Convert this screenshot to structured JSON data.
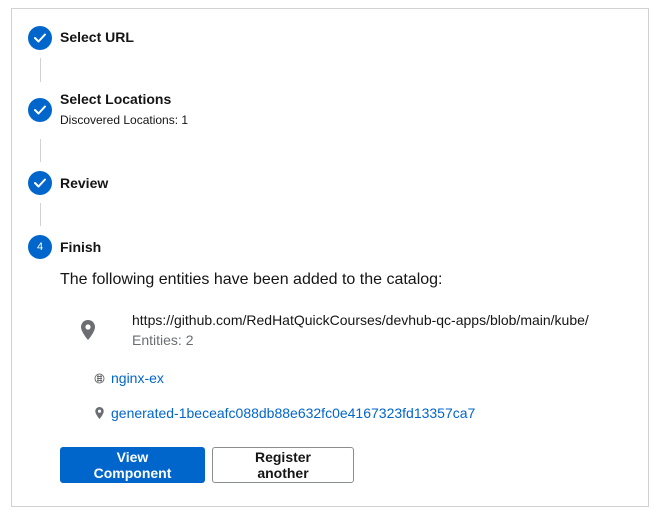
{
  "steps": [
    {
      "title": "Select URL",
      "status": "complete"
    },
    {
      "title": "Select Locations",
      "description": "Discovered Locations: 1",
      "status": "complete"
    },
    {
      "title": "Review",
      "status": "complete"
    },
    {
      "number": "4",
      "title": "Finish",
      "status": "current"
    }
  ],
  "finish": {
    "intro": "The following entities have been added to the catalog:",
    "location": {
      "url": "https://github.com/RedHatQuickCourses/devhub-qc-apps/blob/main/kube/",
      "entities_count": "Entities: 2"
    },
    "entities": [
      {
        "name": "nginx-ex",
        "icon": "component-icon"
      },
      {
        "name": "generated-1beceafc088db88e632fc0e4167323fd13357ca7",
        "icon": "location-icon"
      }
    ]
  },
  "actions": {
    "view_component": "View Component",
    "register_another": "Register another"
  },
  "colors": {
    "accent": "#0066cc",
    "border": "#d2d2d2",
    "muted": "#6a6e73"
  }
}
